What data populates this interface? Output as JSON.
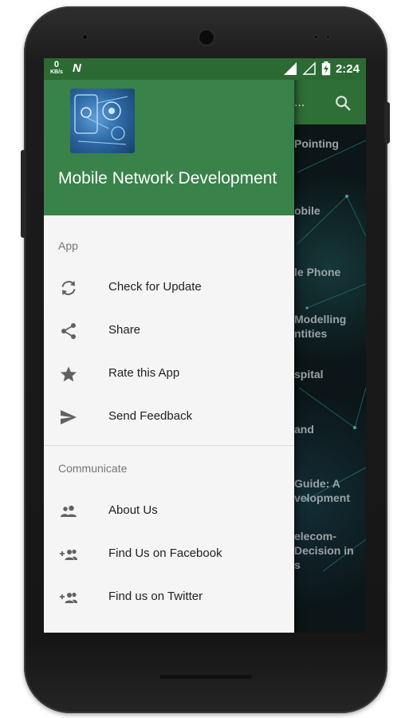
{
  "status_bar": {
    "speed_value": "0",
    "speed_unit": "KB/s",
    "notification_glyph": "N",
    "time": "2:24",
    "icons": [
      "signal-icon",
      "signal-outline-icon",
      "battery-charging-icon"
    ]
  },
  "app_bar": {
    "overflow_text": "...",
    "search_icon": "search-icon"
  },
  "background_list": [
    "Pointing",
    "obile",
    "le Phone",
    "Modelling",
    "ntities",
    "spital",
    "and",
    "Guide: A",
    "velopment",
    "elecom-",
    "Decision in",
    "s"
  ],
  "drawer": {
    "app_title": "Mobile Network Development",
    "sections": [
      {
        "label": "App",
        "items": [
          {
            "label": "Check for Update",
            "icon": "refresh-icon"
          },
          {
            "label": "Share",
            "icon": "share-icon"
          },
          {
            "label": "Rate this App",
            "icon": "star-icon"
          },
          {
            "label": "Send Feedback",
            "icon": "send-icon"
          }
        ]
      },
      {
        "label": "Communicate",
        "items": [
          {
            "label": "About Us",
            "icon": "people-icon"
          },
          {
            "label": "Find Us on Facebook",
            "icon": "add-group-icon"
          },
          {
            "label": "Find us on Twitter",
            "icon": "add-group-icon"
          }
        ]
      }
    ]
  },
  "colors": {
    "status_bar": "#2b6a33",
    "app_bar": "#2e6e37",
    "drawer_header": "#39824a",
    "drawer_bg": "#f5f5f5",
    "text_primary": "#212121",
    "text_secondary": "#757575",
    "icon": "#616161"
  }
}
